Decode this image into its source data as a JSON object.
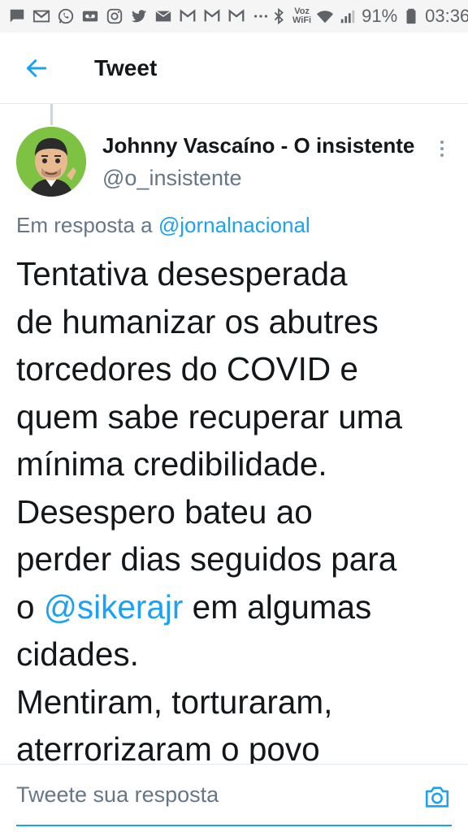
{
  "status_bar": {
    "voz": "Voz",
    "wifi": "WiFi",
    "battery": "91%",
    "time": "03:36",
    "icons": [
      "chat-icon",
      "gmail-icon",
      "whatsapp-icon",
      "voicemail-icon",
      "instagram-icon",
      "twitter-icon",
      "email-icon",
      "gmail-icon",
      "gmail-icon",
      "gmail-icon",
      "more-icon",
      "bluetooth-icon",
      "wifi-icon",
      "signal-icon",
      "battery-icon"
    ]
  },
  "header": {
    "title": "Tweet"
  },
  "tweet": {
    "author_name": "Johnny Vascaíno - O insistente",
    "author_handle": "@o_insistente",
    "reply_prefix": "Em resposta a ",
    "reply_mention": "@jornalnacional",
    "lines": [
      "Tentativa desesperada",
      "de humanizar os abutres",
      "torcedores do COVID e",
      "quem sabe recuperar uma",
      "mínima credibilidade.",
      "Desespero bateu ao",
      "perder dias seguidos para"
    ],
    "line8_prefix": "o ",
    "line8_mention": "@sikerajr",
    "line8_suffix": " em algumas",
    "lines_after": [
      "cidades.",
      "Mentiram, torturaram,",
      "aterrorizaram o povo"
    ]
  },
  "reply_bar": {
    "placeholder": "Tweete sua resposta"
  },
  "colors": {
    "accent": "#1da1f2",
    "secondary_text": "#657786",
    "avatar_bg": "#7dc242"
  }
}
